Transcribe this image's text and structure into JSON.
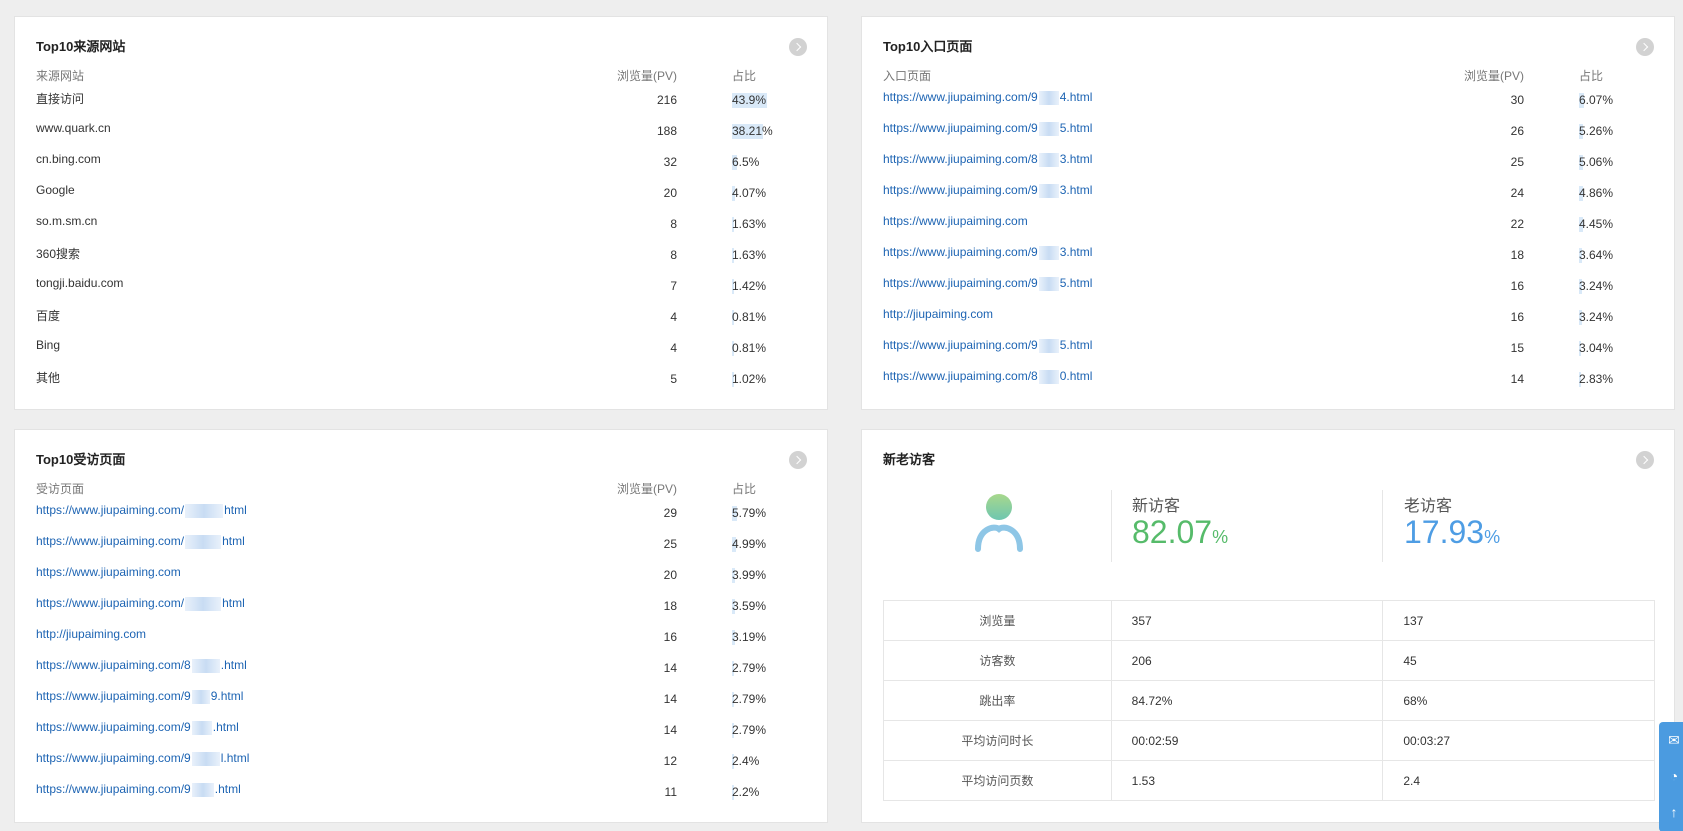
{
  "sources": {
    "title": "Top10来源网站",
    "headers": {
      "name": "来源网站",
      "pv": "浏览量(PV)",
      "pct": "占比"
    },
    "rows": [
      {
        "name": "直接访问",
        "pv": "216",
        "pct": "43.9%",
        "ratio": 0.439
      },
      {
        "name": "www.quark.cn",
        "pv": "188",
        "pct": "38.21%",
        "ratio": 0.3821
      },
      {
        "name": "cn.bing.com",
        "pv": "32",
        "pct": "6.5%",
        "ratio": 0.065
      },
      {
        "name": "Google",
        "pv": "20",
        "pct": "4.07%",
        "ratio": 0.0407
      },
      {
        "name": "so.m.sm.cn",
        "pv": "8",
        "pct": "1.63%",
        "ratio": 0.0163
      },
      {
        "name": "360搜索",
        "pv": "8",
        "pct": "1.63%",
        "ratio": 0.0163
      },
      {
        "name": "tongji.baidu.com",
        "pv": "7",
        "pct": "1.42%",
        "ratio": 0.0142
      },
      {
        "name": "百度",
        "pv": "4",
        "pct": "0.81%",
        "ratio": 0.0081
      },
      {
        "name": "Bing",
        "pv": "4",
        "pct": "0.81%",
        "ratio": 0.0081
      },
      {
        "name": "其他",
        "pv": "5",
        "pct": "1.02%",
        "ratio": 0.0102
      }
    ]
  },
  "entry_pages": {
    "title": "Top10入口页面",
    "headers": {
      "name": "入口页面",
      "pv": "浏览量(PV)",
      "pct": "占比"
    },
    "rows": [
      {
        "pre": "https://www.jiupaiming.com/9",
        "post": "4.html",
        "pv": "30",
        "pct": "6.07%",
        "ratio": 0.0607
      },
      {
        "pre": "https://www.jiupaiming.com/9",
        "post": "5.html",
        "pv": "26",
        "pct": "5.26%",
        "ratio": 0.0526
      },
      {
        "pre": "https://www.jiupaiming.com/8",
        "post": "3.html",
        "pv": "25",
        "pct": "5.06%",
        "ratio": 0.0506
      },
      {
        "pre": "https://www.jiupaiming.com/9",
        "post": "3.html",
        "pv": "24",
        "pct": "4.86%",
        "ratio": 0.0486
      },
      {
        "pre": "https://www.jiupaiming.com",
        "post": "",
        "pv": "22",
        "pct": "4.45%",
        "ratio": 0.0445
      },
      {
        "pre": "https://www.jiupaiming.com/9",
        "post": "3.html",
        "pv": "18",
        "pct": "3.64%",
        "ratio": 0.0364
      },
      {
        "pre": "https://www.jiupaiming.com/9",
        "post": "5.html",
        "pv": "16",
        "pct": "3.24%",
        "ratio": 0.0324
      },
      {
        "pre": "http://jiupaiming.com",
        "post": "",
        "pv": "16",
        "pct": "3.24%",
        "ratio": 0.0324
      },
      {
        "pre": "https://www.jiupaiming.com/9",
        "post": "5.html",
        "pv": "15",
        "pct": "3.04%",
        "ratio": 0.0304
      },
      {
        "pre": "https://www.jiupaiming.com/8",
        "post": "0.html",
        "pv": "14",
        "pct": "2.83%",
        "ratio": 0.0283
      }
    ]
  },
  "visited_pages": {
    "title": "Top10受访页面",
    "headers": {
      "name": "受访页面",
      "pv": "浏览量(PV)",
      "pct": "占比"
    },
    "rows": [
      {
        "pre": "https://www.jiupaiming.com/",
        "post": "html",
        "pv": "29",
        "pct": "5.79%",
        "ratio": 0.0579
      },
      {
        "pre": "https://www.jiupaiming.com/",
        "post": "html",
        "pv": "25",
        "pct": "4.99%",
        "ratio": 0.0499
      },
      {
        "pre": "https://www.jiupaiming.com",
        "post": "",
        "pv": "20",
        "pct": "3.99%",
        "ratio": 0.0399
      },
      {
        "pre": "https://www.jiupaiming.com/",
        "post": "html",
        "pv": "18",
        "pct": "3.59%",
        "ratio": 0.0359
      },
      {
        "pre": "http://jiupaiming.com",
        "post": "",
        "pv": "16",
        "pct": "3.19%",
        "ratio": 0.0319
      },
      {
        "pre": "https://www.jiupaiming.com/8",
        "post": ".html",
        "pv": "14",
        "pct": "2.79%",
        "ratio": 0.0279
      },
      {
        "pre": "https://www.jiupaiming.com/9",
        "post": "9.html",
        "pv": "14",
        "pct": "2.79%",
        "ratio": 0.0279
      },
      {
        "pre": "https://www.jiupaiming.com/9",
        "post": ".html",
        "pv": "14",
        "pct": "2.79%",
        "ratio": 0.0279
      },
      {
        "pre": "https://www.jiupaiming.com/9",
        "post": "l.html",
        "pv": "12",
        "pct": "2.4%",
        "ratio": 0.024
      },
      {
        "pre": "https://www.jiupaiming.com/9",
        "post": ".html",
        "pv": "11",
        "pct": "2.2%",
        "ratio": 0.022
      }
    ]
  },
  "visitors": {
    "title": "新老访客",
    "new_label": "新访客",
    "new_value": "82.07",
    "old_label": "老访客",
    "old_value": "17.93",
    "percent_sign": "%",
    "new_color": "#56bb6a",
    "old_color": "#4e9de4",
    "rows": [
      {
        "metric": "浏览量",
        "new": "357",
        "old": "137"
      },
      {
        "metric": "访客数",
        "new": "206",
        "old": "45"
      },
      {
        "metric": "跳出率",
        "new": "84.72%",
        "old": "68%"
      },
      {
        "metric": "平均访问时长",
        "new": "00:02:59",
        "old": "00:03:27"
      },
      {
        "metric": "平均访问页数",
        "new": "1.53",
        "old": "2.4"
      }
    ]
  },
  "icons": {
    "more": "chevron-right-icon",
    "mail": "mail-icon",
    "wechat": "wechat-icon",
    "top": "arrow-up-icon"
  }
}
